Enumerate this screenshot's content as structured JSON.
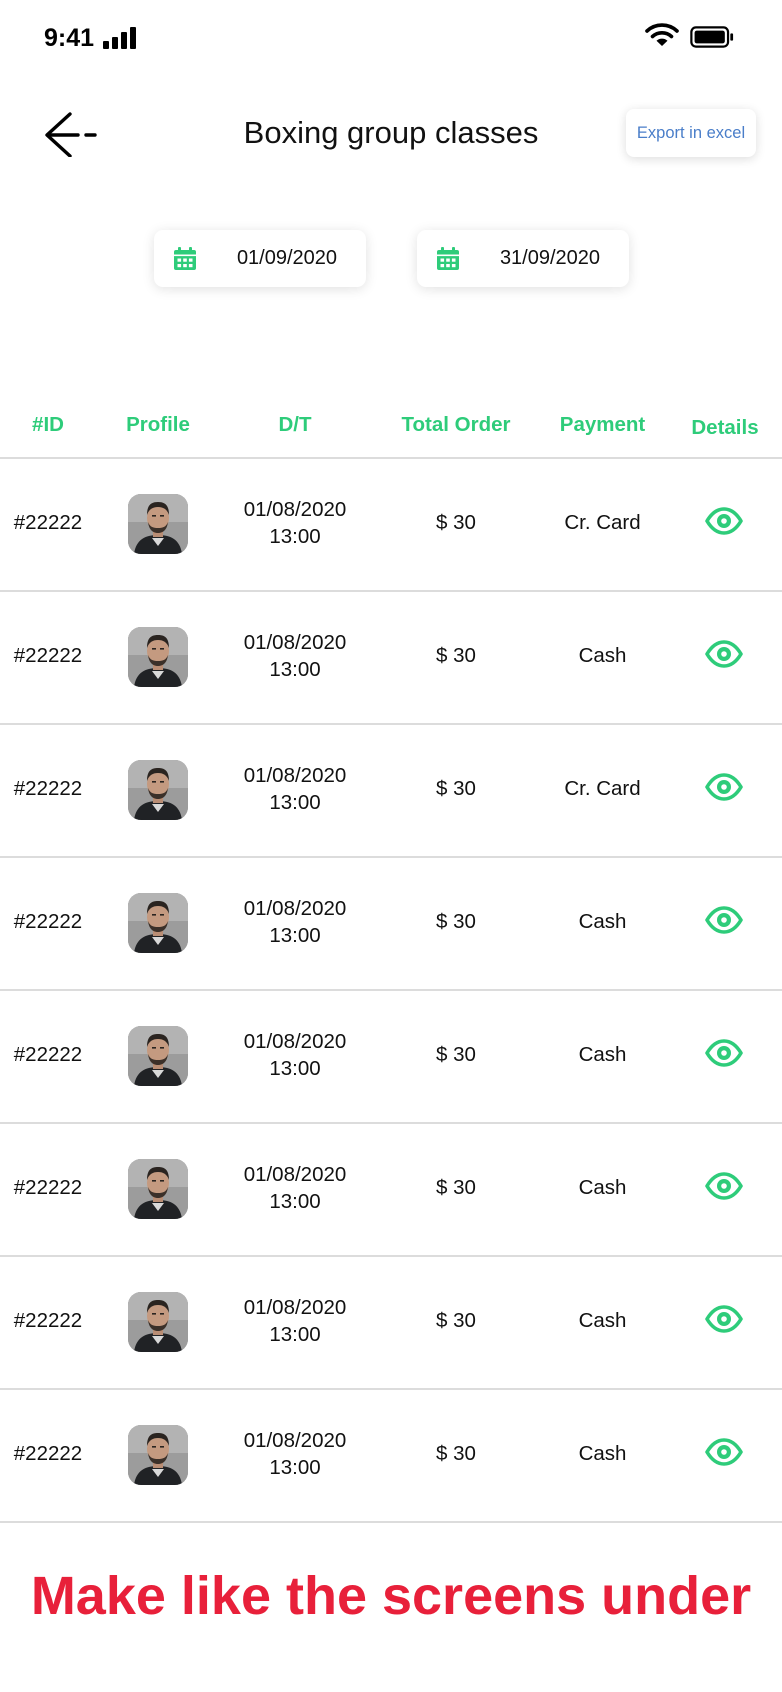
{
  "status_bar": {
    "time": "9:41"
  },
  "header": {
    "title": "Boxing group classes",
    "export_label": "Export in excel"
  },
  "date_range": {
    "start": "01/09/2020",
    "end": "31/09/2020"
  },
  "table": {
    "headers": {
      "id": "#ID",
      "profile": "Profile",
      "dt": "D/T",
      "total": "Total Order",
      "payment": "Payment",
      "details": "Details"
    },
    "rows": [
      {
        "id": "#22222",
        "date": "01/08/2020",
        "time": "13:00",
        "total": "$ 30",
        "payment": "Cr. Card"
      },
      {
        "id": "#22222",
        "date": "01/08/2020",
        "time": "13:00",
        "total": "$ 30",
        "payment": "Cash"
      },
      {
        "id": "#22222",
        "date": "01/08/2020",
        "time": "13:00",
        "total": "$ 30",
        "payment": "Cr. Card"
      },
      {
        "id": "#22222",
        "date": "01/08/2020",
        "time": "13:00",
        "total": "$ 30",
        "payment": "Cash"
      },
      {
        "id": "#22222",
        "date": "01/08/2020",
        "time": "13:00",
        "total": "$ 30",
        "payment": "Cash"
      },
      {
        "id": "#22222",
        "date": "01/08/2020",
        "time": "13:00",
        "total": "$ 30",
        "payment": "Cash"
      },
      {
        "id": "#22222",
        "date": "01/08/2020",
        "time": "13:00",
        "total": "$ 30",
        "payment": "Cash"
      },
      {
        "id": "#22222",
        "date": "01/08/2020",
        "time": "13:00",
        "total": "$ 30",
        "payment": "Cash"
      }
    ]
  },
  "footer_note": "Make like the screens under",
  "colors": {
    "accent": "#2ecc7a",
    "export_text": "#4a7ec9",
    "note": "#e8203a",
    "divider": "#dcdcdc"
  },
  "icons": [
    "signal-icon",
    "wifi-icon",
    "battery-icon",
    "back-arrow-icon",
    "calendar-icon",
    "eye-icon"
  ]
}
